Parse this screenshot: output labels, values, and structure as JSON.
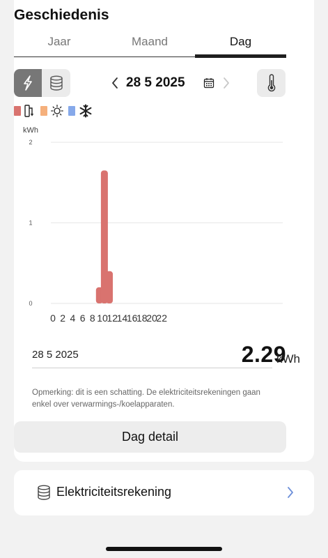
{
  "header": {
    "title": "Geschiedenis"
  },
  "tabs": [
    {
      "label": "Jaar",
      "active": false
    },
    {
      "label": "Maand",
      "active": false
    },
    {
      "label": "Dag",
      "active": true
    }
  ],
  "toolbar": {
    "mode_icons": [
      "lightning-icon",
      "database-icon"
    ],
    "active_mode": "lightning-icon",
    "date": "28 5 2025",
    "thermometer_icon": "thermometer-icon"
  },
  "legend": [
    {
      "color": "#d9736f",
      "icon": "heater-icon"
    },
    {
      "color": "#f5b07c",
      "icon": "sun-icon"
    },
    {
      "color": "#86a9ea",
      "icon": "snowflake-icon"
    }
  ],
  "chart_data": {
    "type": "bar",
    "ylabel": "kWh",
    "ylim": [
      0,
      2
    ],
    "yticks": [
      "2",
      "1",
      "0"
    ],
    "xticks": [
      "0",
      "2",
      "4",
      "6",
      "8",
      "10",
      "12",
      "14",
      "16",
      "18",
      "20",
      "22"
    ],
    "x": [
      8,
      9,
      10
    ],
    "series": [
      {
        "color": "#d9736f",
        "values": [
          0.2,
          1.65,
          0.4
        ]
      }
    ],
    "grid": true
  },
  "summary": {
    "date": "28 5 2025",
    "value": "2.29",
    "unit": "kWh"
  },
  "note": "Opmerking: dit is een schatting. De elektriciteitsrekeningen gaan enkel over verwarmings-/koelapparaten.",
  "detail_button": "Dag detail",
  "bill": {
    "label": "Elektriciteitsrekening"
  },
  "colors": {
    "accent_chevron": "#6c8fd9",
    "active_toggle": "#777777",
    "bar": "#d9736f"
  }
}
